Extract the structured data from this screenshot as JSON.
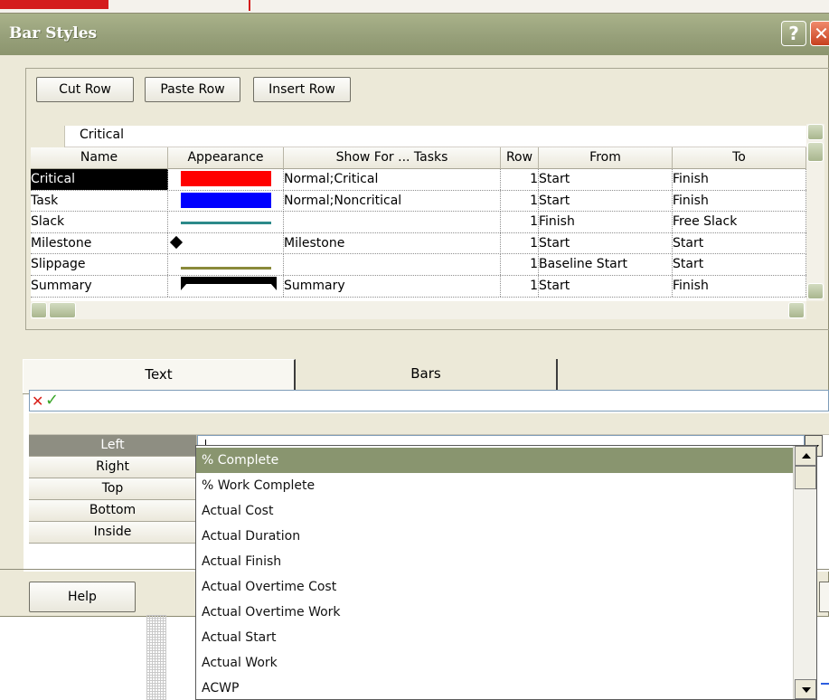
{
  "window": {
    "title": "Bar Styles"
  },
  "toolbar": {
    "cut_row": "Cut Row",
    "paste_row": "Paste Row",
    "insert_row": "Insert Row"
  },
  "grid": {
    "edit_value": "Critical",
    "headers": [
      "Name",
      "Appearance",
      "Show For ... Tasks",
      "Row",
      "From",
      "To"
    ],
    "rows": [
      {
        "name": "Critical",
        "appearance": "red-bar",
        "show_for": "Normal;Critical",
        "row": "1",
        "from": "Start",
        "to": "Finish"
      },
      {
        "name": "Task",
        "appearance": "blue-bar",
        "show_for": "Normal;Noncritical",
        "row": "1",
        "from": "Start",
        "to": "Finish"
      },
      {
        "name": "Slack",
        "appearance": "teal-line",
        "show_for": "",
        "row": "1",
        "from": "Finish",
        "to": "Free Slack"
      },
      {
        "name": "Milestone",
        "appearance": "diamond",
        "show_for": "Milestone",
        "row": "1",
        "from": "Start",
        "to": "Start"
      },
      {
        "name": "Slippage",
        "appearance": "olive-line",
        "show_for": "",
        "row": "1",
        "from": "Baseline Start",
        "to": "Start"
      },
      {
        "name": "Summary",
        "appearance": "summary-bar",
        "show_for": "Summary",
        "row": "1",
        "from": "Start",
        "to": "Finish"
      }
    ]
  },
  "tabs": {
    "text": "Text",
    "bars": "Bars"
  },
  "text_fields": {
    "labels": [
      "Left",
      "Right",
      "Top",
      "Bottom",
      "Inside"
    ]
  },
  "dropdown": {
    "items": [
      "% Complete",
      "% Work Complete",
      "Actual Cost",
      "Actual Duration",
      "Actual Finish",
      "Actual Overtime Cost",
      "Actual Overtime Work",
      "Actual Start",
      "Actual Work",
      "ACWP"
    ]
  },
  "footer": {
    "help": "Help"
  },
  "colors": {
    "critical": "#ff0000",
    "task": "#0000ff",
    "slack": "#2c8a8a",
    "slippage": "#8a8a3a",
    "summary": "#000000",
    "highlight": "#89956f"
  }
}
